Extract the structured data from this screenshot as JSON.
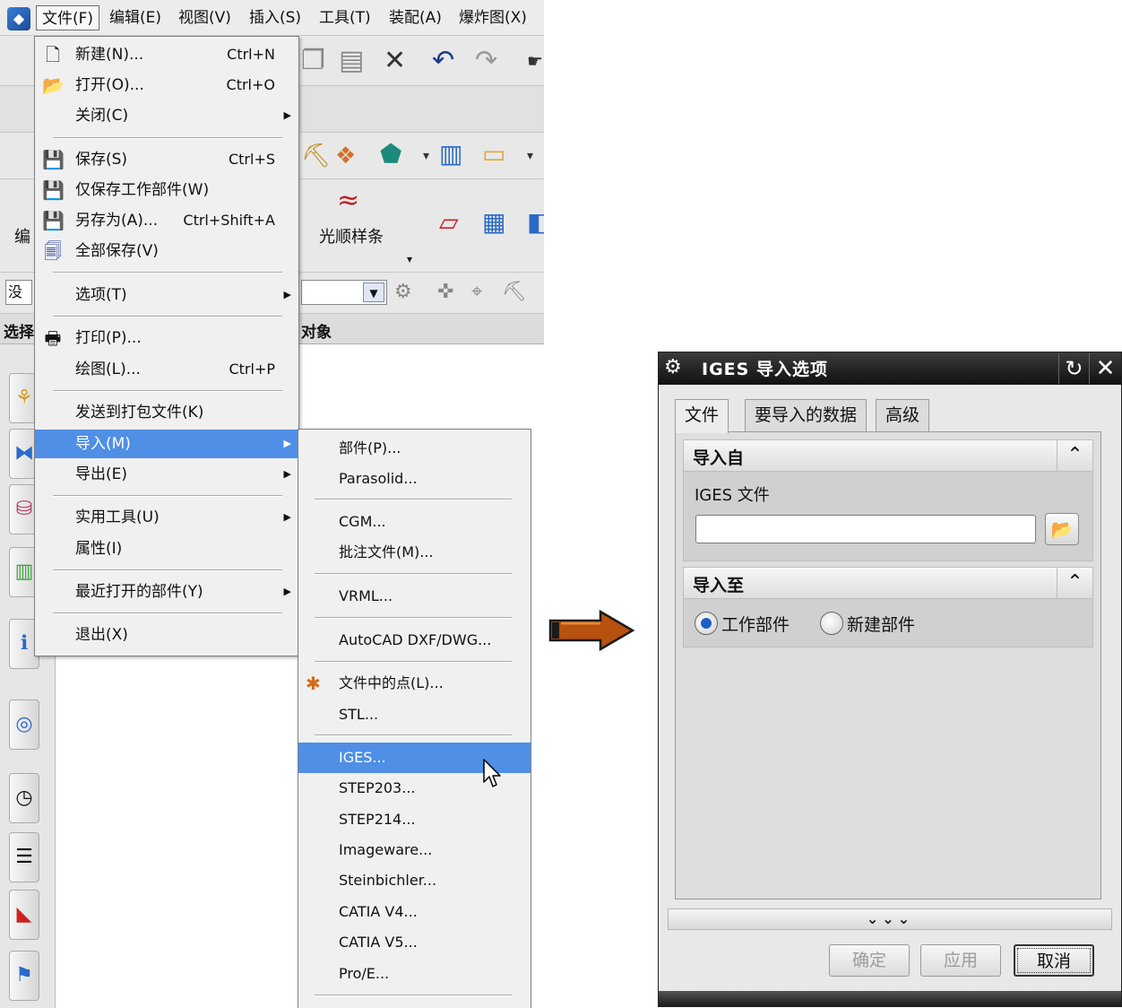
{
  "menubar": {
    "items": [
      "文件(F)",
      "编辑(E)",
      "视图(V)",
      "插入(S)",
      "工具(T)",
      "装配(A)",
      "爆炸图(X)"
    ]
  },
  "toolbar": {
    "smooth_spline_label": "光顺样条",
    "edit_partial_label": "编",
    "selection_filter_partial": "没有",
    "selection_partial": "选择",
    "selection_object_label": "对象"
  },
  "file_menu": {
    "items": [
      {
        "label": "新建(N)...",
        "shortcut": "Ctrl+N",
        "icon": "new-file-icon"
      },
      {
        "label": "打开(O)...",
        "shortcut": "Ctrl+O",
        "icon": "open-folder-icon"
      },
      {
        "label": "关闭(C)",
        "shortcut": "",
        "submenu": true
      },
      {
        "label": "保存(S)",
        "shortcut": "Ctrl+S",
        "icon": "save-icon"
      },
      {
        "label": "仅保存工作部件(W)",
        "shortcut": "",
        "icon": "save-work-part-icon"
      },
      {
        "label": "另存为(A)...",
        "shortcut": "Ctrl+Shift+A",
        "icon": "save-as-icon"
      },
      {
        "label": "全部保存(V)",
        "shortcut": "",
        "icon": "save-all-icon"
      },
      {
        "label": "选项(T)",
        "shortcut": "",
        "submenu": true
      },
      {
        "label": "打印(P)...",
        "shortcut": "",
        "icon": "print-icon"
      },
      {
        "label": "绘图(L)...",
        "shortcut": "Ctrl+P"
      },
      {
        "label": "发送到打包文件(K)",
        "shortcut": ""
      },
      {
        "label": "导入(M)",
        "shortcut": "",
        "submenu": true,
        "highlighted": true
      },
      {
        "label": "导出(E)",
        "shortcut": "",
        "submenu": true
      },
      {
        "label": "实用工具(U)",
        "shortcut": "",
        "submenu": true
      },
      {
        "label": "属性(I)",
        "shortcut": ""
      },
      {
        "label": "最近打开的部件(Y)",
        "shortcut": "",
        "submenu": true
      },
      {
        "label": "退出(X)",
        "shortcut": ""
      }
    ]
  },
  "import_menu": {
    "items": [
      {
        "label": "部件(P)..."
      },
      {
        "label": "Parasolid..."
      },
      {
        "label": "CGM..."
      },
      {
        "label": "批注文件(M)..."
      },
      {
        "label": "VRML..."
      },
      {
        "label": "AutoCAD DXF/DWG..."
      },
      {
        "label": "文件中的点(L)...",
        "icon": "points-from-file-icon"
      },
      {
        "label": "STL..."
      },
      {
        "label": "IGES...",
        "highlighted": true
      },
      {
        "label": "STEP203..."
      },
      {
        "label": "STEP214..."
      },
      {
        "label": "Imageware..."
      },
      {
        "label": "Steinbichler..."
      },
      {
        "label": "CATIA V4..."
      },
      {
        "label": "CATIA V5..."
      },
      {
        "label": "Pro/E..."
      }
    ]
  },
  "dialog": {
    "title": "IGES 导入选项",
    "tabs": [
      "文件",
      "要导入的数据",
      "高级"
    ],
    "active_tab": "文件",
    "import_from": {
      "header": "导入自",
      "file_label": "IGES 文件",
      "file_value": ""
    },
    "import_to": {
      "header": "导入至",
      "options": [
        "工作部件",
        "新建部件"
      ],
      "selected": "工作部件"
    },
    "more_glyph": "⌄⌄⌄",
    "buttons": {
      "ok": "确定",
      "apply": "应用",
      "cancel": "取消"
    }
  },
  "colors": {
    "menu_highlight": "#4f8fe6",
    "dialog_title_bg": "#111111",
    "arrow_fill": "#b8500f"
  }
}
